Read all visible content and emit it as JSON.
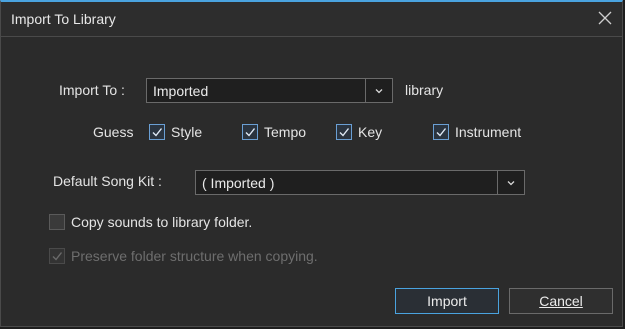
{
  "dialog": {
    "title": "Import To Library",
    "import_to_label": "Import To :",
    "import_to_value": "Imported",
    "library_suffix": "library",
    "guess_label": "Guess",
    "guess_options": [
      {
        "label": "Style",
        "checked": true
      },
      {
        "label": "Tempo",
        "checked": true
      },
      {
        "label": "Key",
        "checked": true
      },
      {
        "label": "Instrument",
        "checked": true
      }
    ],
    "default_kit_label": "Default Song Kit :",
    "default_kit_value": "( Imported )",
    "copy_sounds_label": "Copy sounds to library folder.",
    "copy_sounds_checked": false,
    "preserve_label": "Preserve folder structure when copying.",
    "preserve_checked": true,
    "import_button": "Import",
    "cancel_button": "Cancel"
  },
  "icons": {
    "close": "close-icon",
    "dropdown": "chevron-down-icon",
    "check": "checkmark-icon"
  },
  "colors": {
    "accent": "#4aa3df",
    "background": "#2b2b2b",
    "text": "#e6e6e6",
    "disabled_text": "#6e6e6e"
  }
}
